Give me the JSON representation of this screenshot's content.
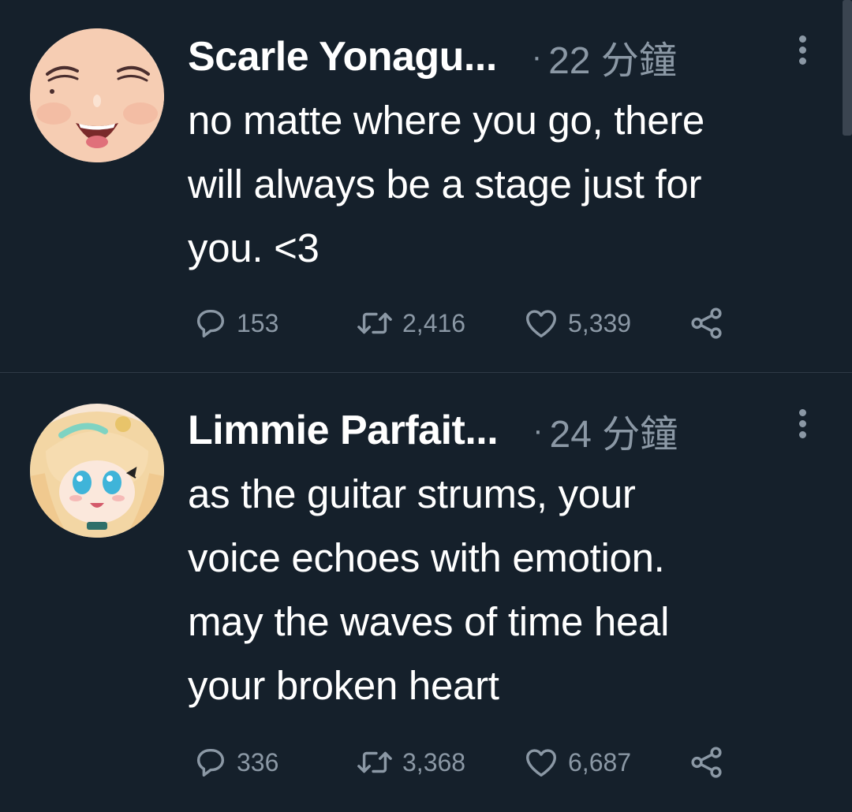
{
  "tweets": [
    {
      "name": "Scarle Yonagu...",
      "separator": "·",
      "time": "22 分鐘",
      "text_lines": [
        "no matte where you go, there",
        "will always be a stage just for",
        "you. <3"
      ],
      "replies": "153",
      "retweets": "2,416",
      "likes": "5,339",
      "avatar": {
        "skin": "#f6cdb3",
        "cheek": "#f2a98e"
      }
    },
    {
      "name": "Limmie Parfait...",
      "separator": "·",
      "time": "24 分鐘",
      "text_lines": [
        "as the guitar strums, your",
        "voice echoes with emotion.",
        "may the waves of time heal",
        "your broken heart"
      ],
      "replies": "336",
      "retweets": "3,368",
      "likes": "6,687",
      "avatar": {
        "hair": "#f3d6a4",
        "eyes": "#3fb4d9"
      }
    }
  ],
  "icons": {
    "reply": "reply-icon",
    "retweet": "retweet-icon",
    "like": "heart-icon",
    "share": "share-icon",
    "more": "more-vertical-icon"
  },
  "colors": {
    "background": "#15202b",
    "text": "#ffffff",
    "secondary": "#8b98a5",
    "divider": "#2f3a46"
  }
}
